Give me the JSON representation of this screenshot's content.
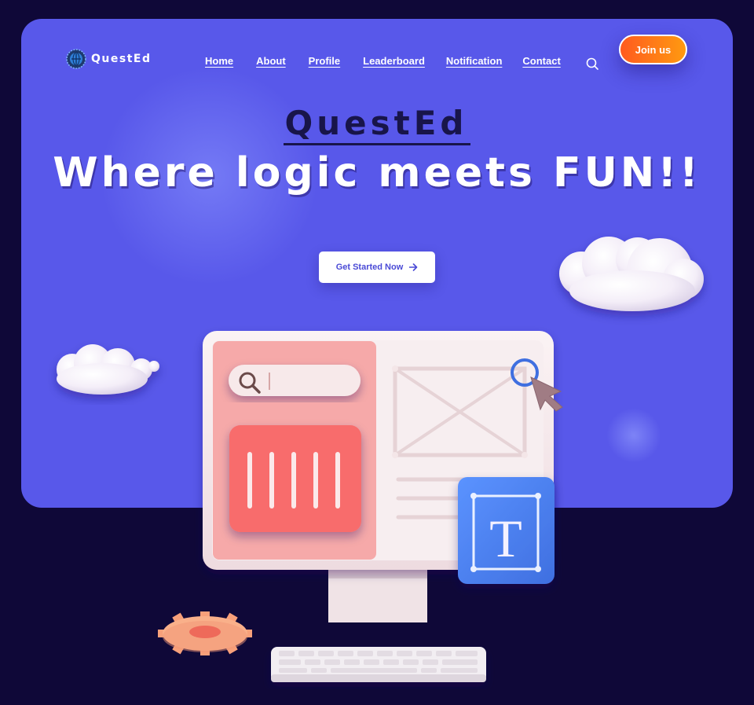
{
  "brand": {
    "name": "QuestEd",
    "logo_icon": "globe-gear-logo-icon"
  },
  "nav": {
    "items": [
      {
        "label": "Home"
      },
      {
        "label": "About"
      },
      {
        "label": "Profile"
      },
      {
        "label": "Leaderboard"
      },
      {
        "label": "Notification"
      },
      {
        "label": "Contact"
      }
    ],
    "search_icon": "search-icon",
    "join_label": "Join us"
  },
  "hero": {
    "title": "QuestEd",
    "tagline": "Where logic meets FUN!!",
    "cta_label": "Get Started Now",
    "cta_icon": "arrow-right-icon",
    "illustration_letter": "T"
  },
  "colors": {
    "background": "#0f0838",
    "hero": "#5858ea",
    "join_gradient_start": "#ff5a1f",
    "join_gradient_end": "#ff9a10",
    "accent_red": "#f8766e",
    "accent_blue": "#4d7ff0"
  }
}
